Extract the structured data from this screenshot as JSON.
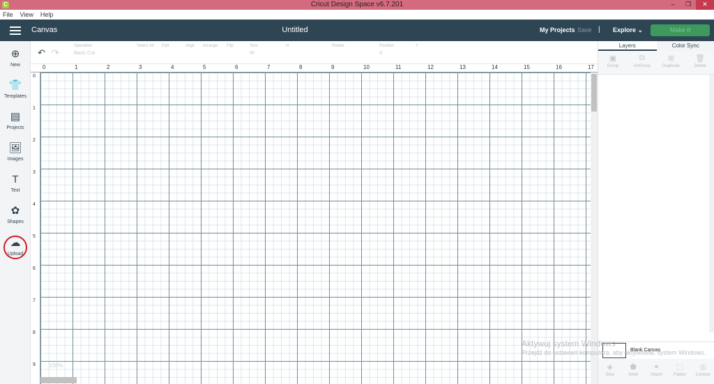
{
  "window": {
    "title": "Cricut Design Space  v6.7.201",
    "minimize": "–",
    "maximize": "❐",
    "close": "✕"
  },
  "menu": [
    "File",
    "View",
    "Help"
  ],
  "header": {
    "section": "Canvas",
    "doc_title": "Untitled",
    "my_projects": "My Projects",
    "save": "Save",
    "separator": "|",
    "explore": "Explore",
    "explore_chevron": "⌄",
    "make_it": "Make It"
  },
  "sidebar": {
    "items": [
      {
        "label": "New",
        "icon": "plus-circle-icon",
        "glyph": "⊕"
      },
      {
        "label": "Templates",
        "icon": "tshirt-icon",
        "glyph": "👕"
      },
      {
        "label": "Projects",
        "icon": "notebook-icon",
        "glyph": "▤"
      },
      {
        "label": "Images",
        "icon": "image-icon",
        "glyph": "🖼"
      },
      {
        "label": "Text",
        "icon": "text-icon",
        "glyph": "T"
      },
      {
        "label": "Shapes",
        "icon": "shapes-icon",
        "glyph": "✿"
      },
      {
        "label": "Upload",
        "icon": "cloud-upload-icon",
        "glyph": "☁"
      }
    ]
  },
  "toolbar": {
    "undo": "↶",
    "redo": "↷",
    "operation_label": "Operation",
    "operation_value": "Basic Cut",
    "select_all": "Select All",
    "edit": "Edit",
    "align": "Align",
    "arrange": "Arrange",
    "flip": "Flip",
    "size": "Size",
    "size_w": "W",
    "size_h": "H",
    "rotate": "Rotate",
    "position": "Position",
    "position_x": "X",
    "position_y": "Y"
  },
  "ruler": {
    "horizontal": [
      "0",
      "1",
      "2",
      "3",
      "4",
      "5",
      "6",
      "7",
      "8",
      "9",
      "10",
      "11",
      "12",
      "13",
      "14",
      "15",
      "16",
      "17"
    ],
    "vertical": [
      "0",
      "1",
      "2",
      "3",
      "4",
      "5",
      "6",
      "7",
      "8",
      "9"
    ]
  },
  "canvas": {
    "zoom_label": "100%"
  },
  "right_panel": {
    "tabs": [
      "Layers",
      "Color Sync"
    ],
    "actions": [
      {
        "label": "Group",
        "glyph": "▣"
      },
      {
        "label": "UnGroup",
        "glyph": "⧉"
      },
      {
        "label": "Duplicate",
        "glyph": "⊞"
      },
      {
        "label": "Delete",
        "glyph": "🗑"
      }
    ],
    "blank_canvas": "Blank Canvas",
    "bottom_actions": [
      {
        "label": "Slice",
        "glyph": "◈"
      },
      {
        "label": "Weld",
        "glyph": "⬟"
      },
      {
        "label": "Attach",
        "glyph": "⚭"
      },
      {
        "label": "Flatten",
        "glyph": "⬚"
      },
      {
        "label": "Contour",
        "glyph": "◎"
      }
    ]
  },
  "watermark": {
    "line1": "Aktywuj system Windows",
    "line2": "Przejdź do ustawień komputera, aby aktywować system Windows."
  },
  "colors": {
    "header": "#2e4553",
    "titlebar": "#d46a7e",
    "make_it": "#3d9a5c",
    "highlight": "#d11a2a"
  }
}
